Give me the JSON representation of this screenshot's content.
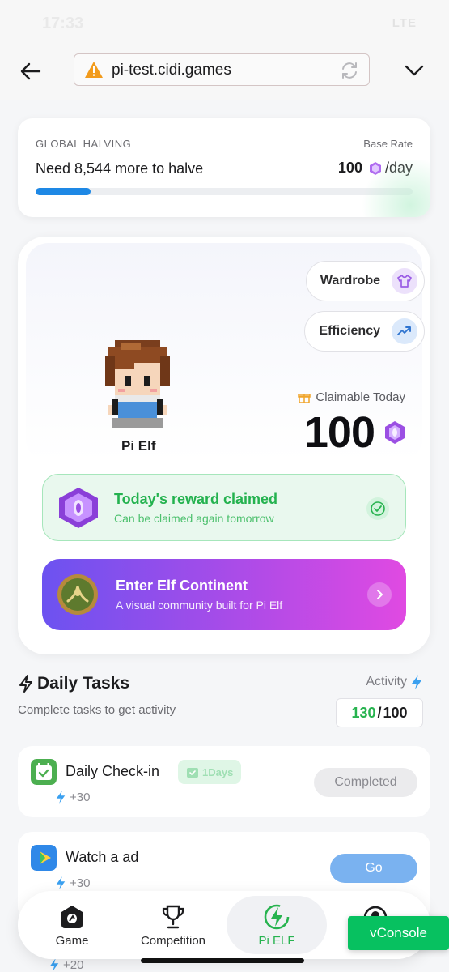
{
  "status_bar": {
    "time": "17:33",
    "network": "LTE"
  },
  "browser": {
    "url": "pi-test.cidi.games"
  },
  "halving": {
    "label": "GLOBAL HALVING",
    "message": "Need 8,544 more to halve",
    "base_rate_label": "Base Rate",
    "base_rate_value": "100",
    "base_rate_unit": "/day",
    "progress_fraction": 0.145,
    "progress_color": "#1e88e5"
  },
  "elf": {
    "wardrobe_label": "Wardrobe",
    "efficiency_label": "Efficiency",
    "name": "Pi Elf",
    "claimable_label": "Claimable Today",
    "claimable_value": "100",
    "reward_title": "Today's reward claimed",
    "reward_subtitle": "Can be claimed again tomorrow",
    "enter_title": "Enter Elf Continent",
    "enter_subtitle": "A visual community built for Pi Elf"
  },
  "daily_tasks": {
    "title": "Daily Tasks",
    "subtitle": "Complete tasks to get activity",
    "activity_label": "Activity",
    "activity_current": "130",
    "activity_sep": "/",
    "activity_max": "100",
    "tasks": [
      {
        "name": "Daily Check-in",
        "badge": "1Days",
        "points": "+30",
        "button": "Completed"
      },
      {
        "name": "Watch a ad",
        "points": "+30",
        "button": "Go"
      },
      {
        "points": "+20"
      }
    ]
  },
  "tabbar": {
    "tabs": [
      {
        "label": "Game"
      },
      {
        "label": "Competition"
      },
      {
        "label": "Pi ELF"
      }
    ]
  },
  "vconsole": {
    "label": "vConsole"
  },
  "colors": {
    "accent_green": "#27b34f",
    "accent_purple": "#b24be7",
    "accent_blue": "#1e88e5"
  }
}
